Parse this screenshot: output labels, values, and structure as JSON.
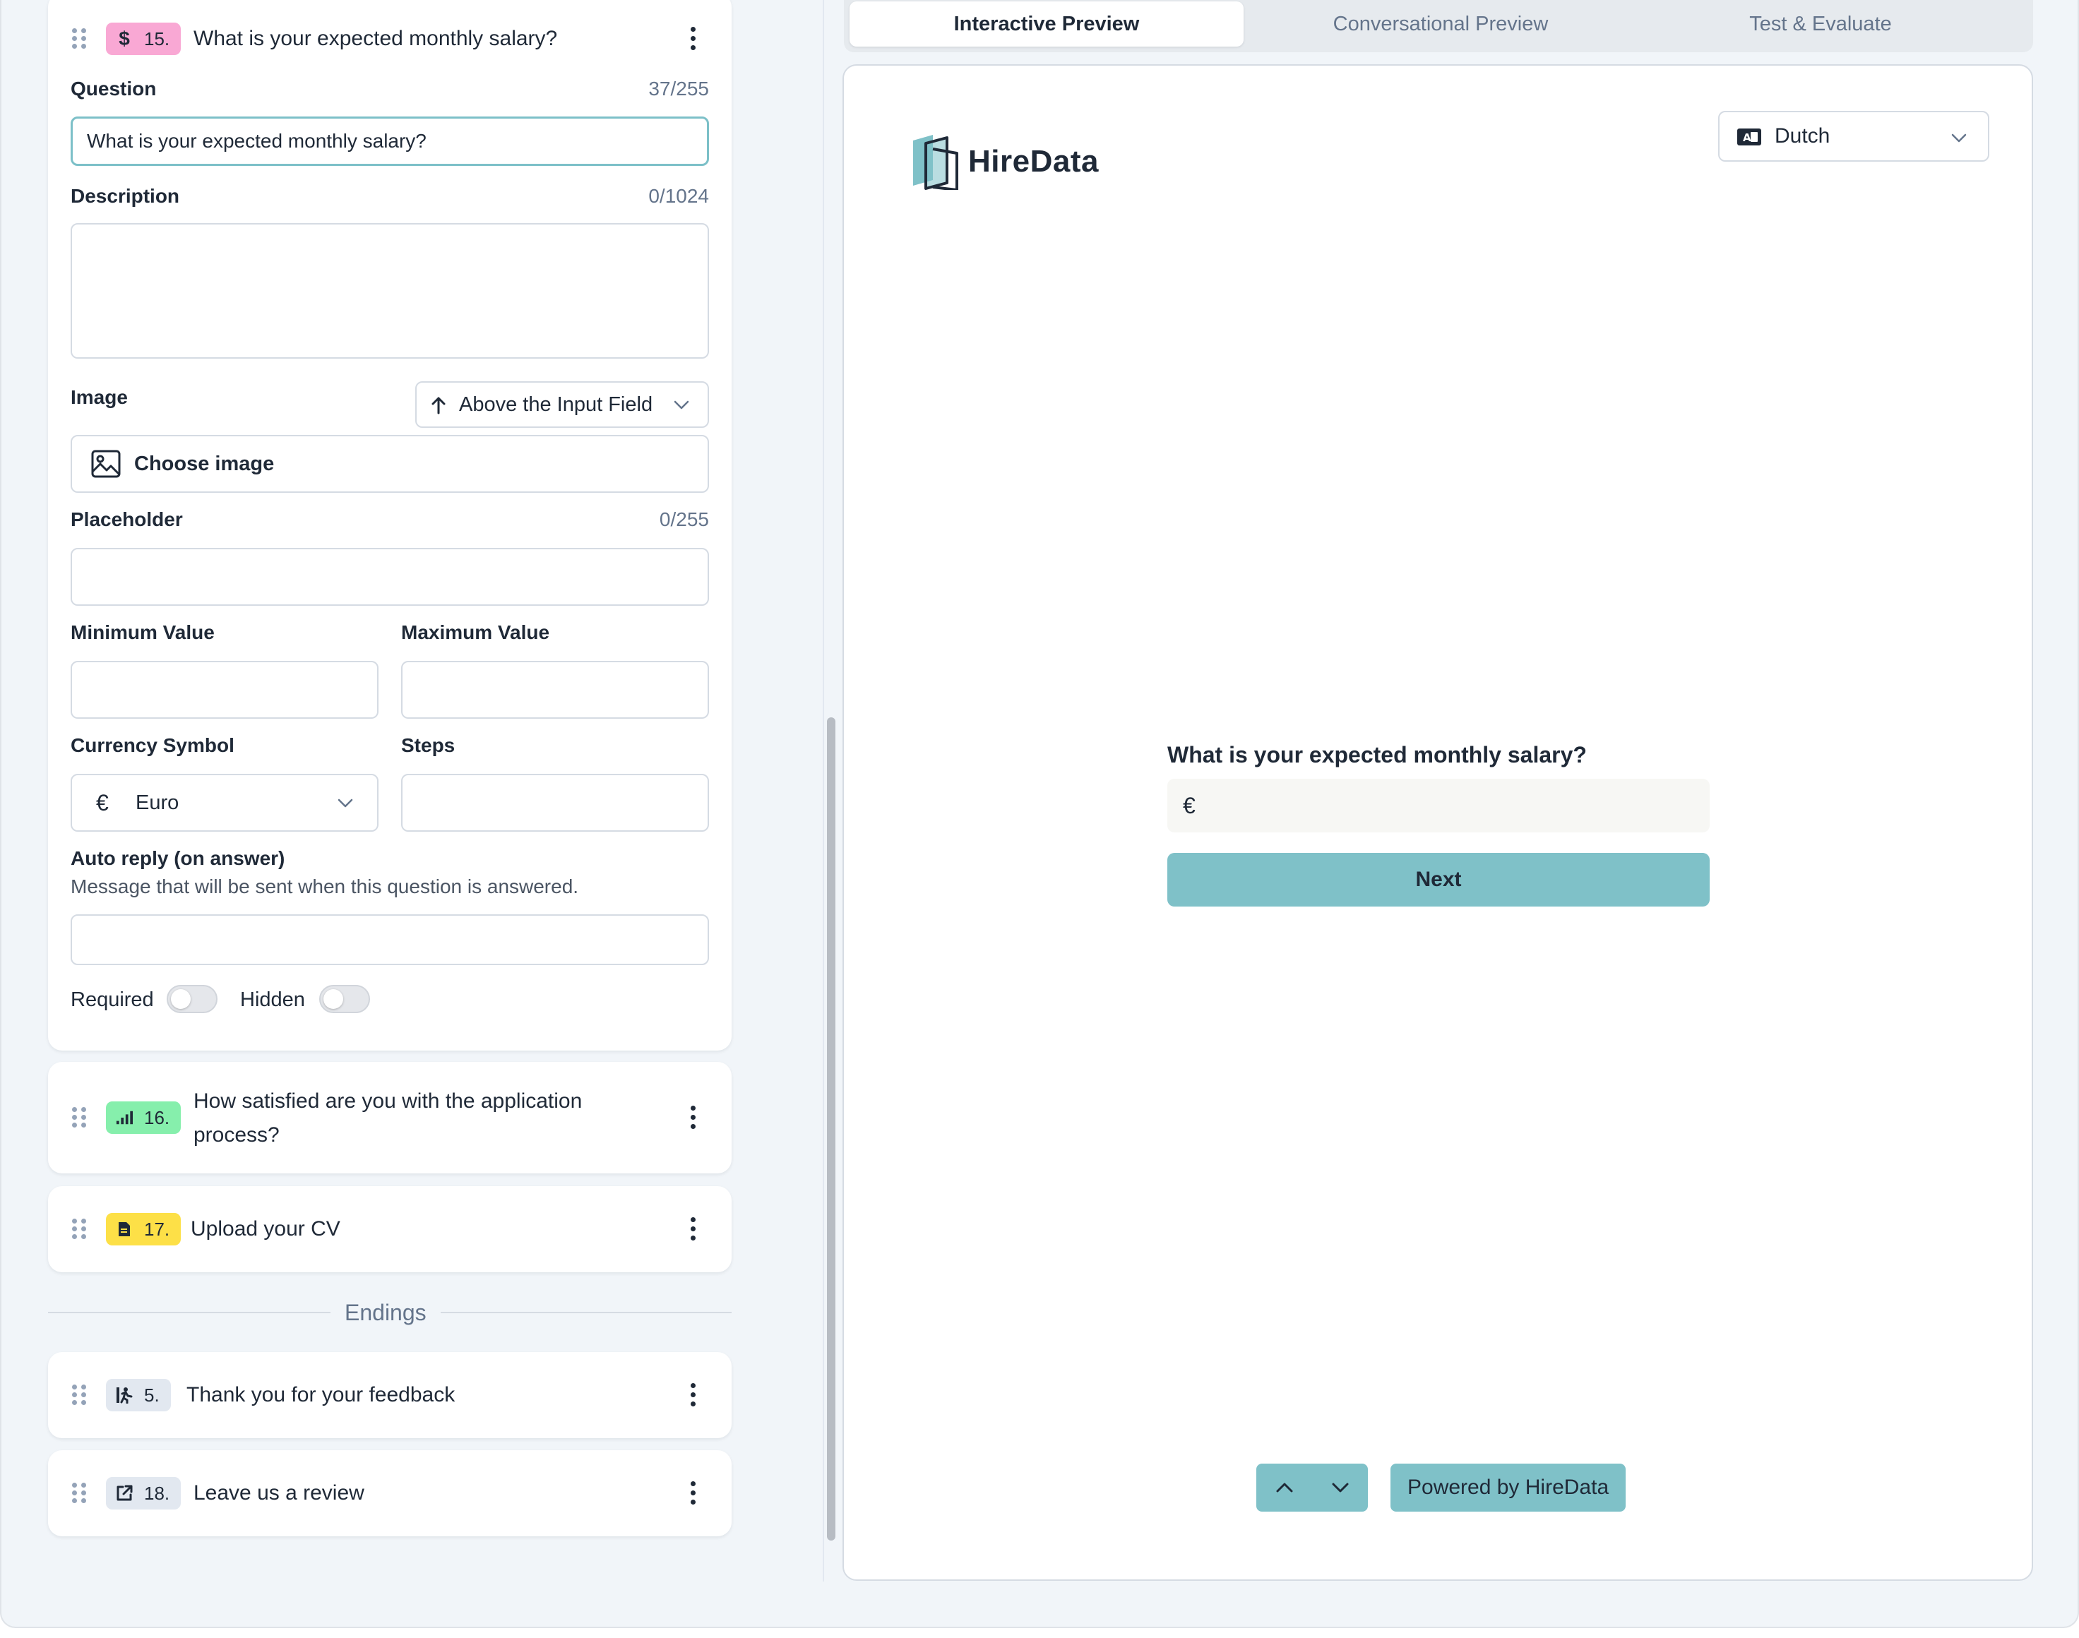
{
  "editor": {
    "active_question": {
      "number": "15.",
      "title": "What is your expected monthly salary?",
      "badge_color": "#f9a8d4",
      "icon": "dollar-icon",
      "question_label": "Question",
      "question_count": "37/255",
      "question_value": "What is your expected monthly salary?",
      "description_label": "Description",
      "description_count": "0/1024",
      "image_label": "Image",
      "image_position": "Above the Input Field",
      "choose_image": "Choose image",
      "placeholder_label": "Placeholder",
      "placeholder_count": "0/255",
      "min_label": "Minimum Value",
      "max_label": "Maximum Value",
      "currency_label": "Currency Symbol",
      "currency_value": "Euro",
      "steps_label": "Steps",
      "auto_reply_label": "Auto reply (on answer)",
      "auto_reply_help": "Message that will be sent when this question is answered.",
      "required_label": "Required",
      "required_on": false,
      "hidden_label": "Hidden",
      "hidden_on": false
    },
    "questions": [
      {
        "number": "16.",
        "title_line1": "How satisfied are you with the application",
        "title_line2": "process?",
        "badge_color": "#86efac",
        "icon": "rating-bars-icon"
      },
      {
        "number": "17.",
        "title": "Upload your CV",
        "badge_color": "#fde047",
        "icon": "file-icon"
      }
    ],
    "endings_label": "Endings",
    "endings": [
      {
        "number": "5.",
        "title": "Thank you for your feedback",
        "badge_color": "#e2e8f0",
        "icon": "exit-icon"
      },
      {
        "number": "18.",
        "title": "Leave us a review",
        "badge_color": "#e2e8f0",
        "icon": "external-link-icon"
      }
    ]
  },
  "preview": {
    "tabs": [
      "Interactive Preview",
      "Conversational Preview",
      "Test & Evaluate"
    ],
    "active_tab": 0,
    "brand": "HireData",
    "language": "Dutch",
    "question": "What is your expected monthly salary?",
    "currency_symbol": "€",
    "next_label": "Next",
    "powered_by": "Powered by HireData",
    "accent_color": "#7fc1c8"
  }
}
